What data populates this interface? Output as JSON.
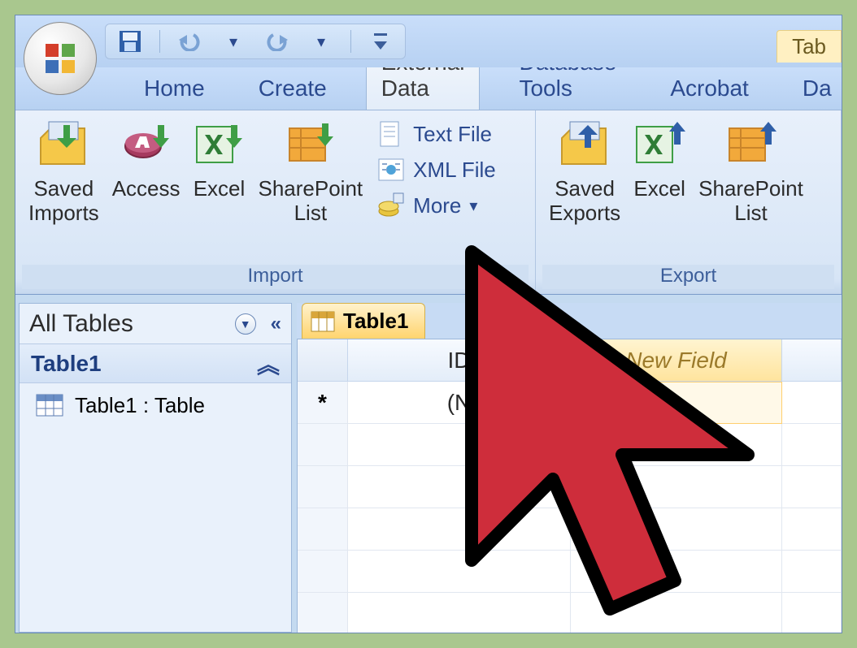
{
  "context_tab": "Tab",
  "tabs": {
    "home": "Home",
    "create": "Create",
    "external_data": "External Data",
    "database_tools": "Database Tools",
    "acrobat": "Acrobat",
    "da": "Da"
  },
  "ribbon": {
    "import": {
      "label": "Import",
      "saved_imports": "Saved\nImports",
      "access": "Access",
      "excel": "Excel",
      "sharepoint": "SharePoint\nList",
      "text_file": "Text File",
      "xml_file": "XML File",
      "more": "More"
    },
    "export": {
      "label": "Export",
      "saved_exports": "Saved\nExports",
      "excel": "Excel",
      "sharepoint": "SharePoint\nList"
    }
  },
  "nav": {
    "title": "All Tables",
    "group": "Table1",
    "item": "Table1 : Table"
  },
  "sheet": {
    "tab": "Table1",
    "col_id": "ID",
    "col_new": "New Field",
    "new_row_marker": "*",
    "new_row_id_partial": "(N"
  }
}
